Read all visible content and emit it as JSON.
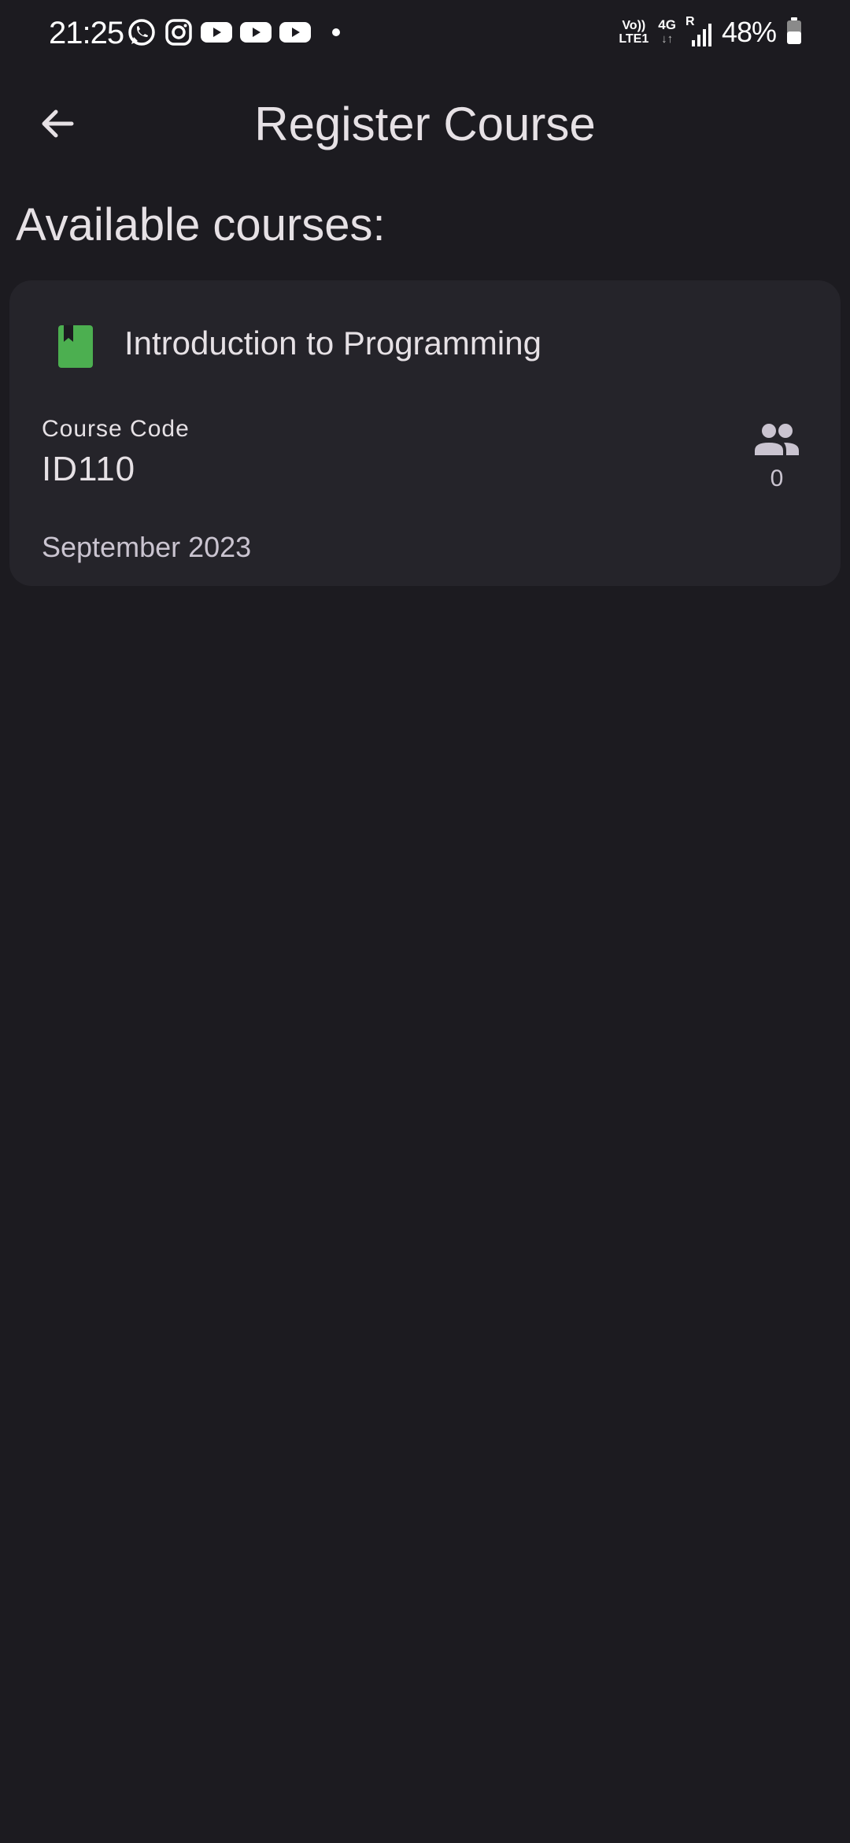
{
  "status_bar": {
    "time": "21:25",
    "notification_icons": [
      "whatsapp-icon",
      "instagram-icon",
      "youtube-icon",
      "youtube-icon",
      "youtube-icon"
    ],
    "volte_top": "Vo))",
    "volte_bottom": "LTE1",
    "network_type": "4G",
    "network_arrows": "↓↑",
    "roaming": "R",
    "battery_percent": "48%"
  },
  "app_bar": {
    "title": "Register Course",
    "back_icon": "arrow-back-icon"
  },
  "section_title": "Available courses:",
  "courses": [
    {
      "name": "Introduction to Programming",
      "icon": "book-icon",
      "icon_color": "#4caf50",
      "code_label": "Course Code",
      "code": "ID110",
      "enrolled_icon": "people-icon",
      "enrolled_count": "0",
      "term": "September 2023"
    }
  ],
  "colors": {
    "background": "#1c1b20",
    "card": "#25242a",
    "text_primary": "#e6e1e5",
    "text_secondary": "#cac4d0",
    "accent_green": "#4caf50"
  }
}
